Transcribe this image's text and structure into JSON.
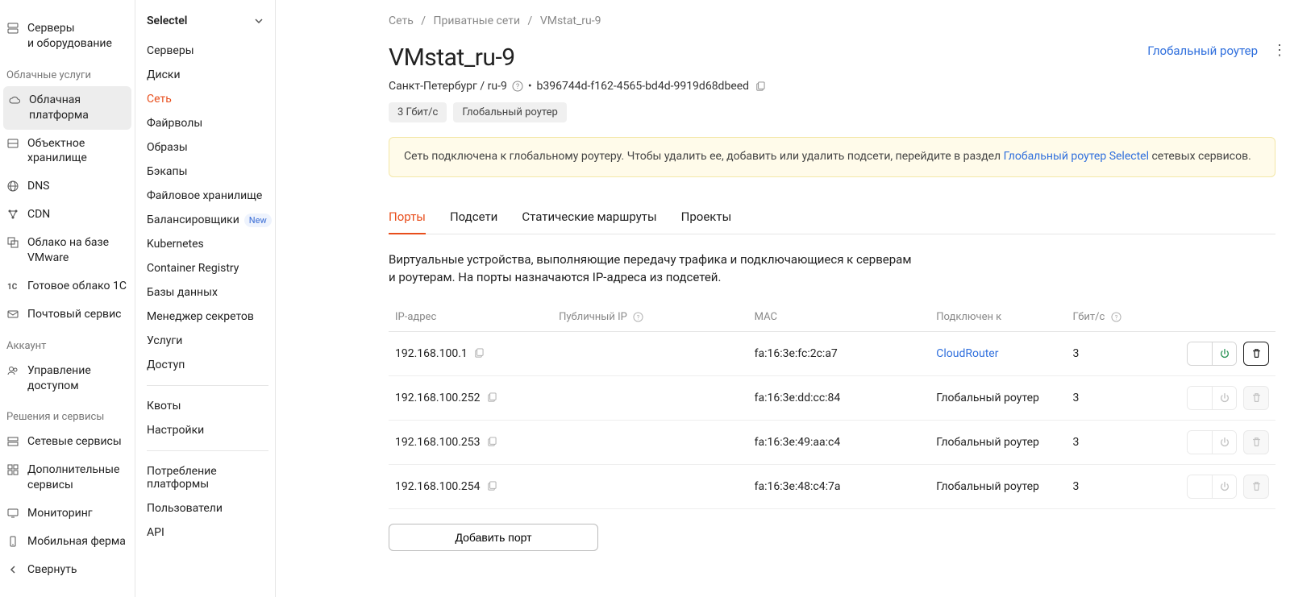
{
  "sidebar1": {
    "items_top": [
      {
        "label": "Серверы и оборудование",
        "icon": "server"
      }
    ],
    "group_cloud_label": "Облачные услуги",
    "items_cloud": [
      {
        "label": "Облачная платформа",
        "icon": "cloud",
        "active": true
      },
      {
        "label": "Объектное хранилище",
        "icon": "storage"
      },
      {
        "label": "DNS",
        "icon": "globe"
      },
      {
        "label": "CDN",
        "icon": "cdn"
      },
      {
        "label": "Облако на базе VMware",
        "icon": "vmware"
      },
      {
        "label": "Готовое облако 1C",
        "icon": "1c"
      },
      {
        "label": "Почтовый сервис",
        "icon": "mail"
      }
    ],
    "group_account_label": "Аккаунт",
    "items_account": [
      {
        "label": "Управление доступом",
        "icon": "users"
      }
    ],
    "group_solutions_label": "Решения и сервисы",
    "items_solutions": [
      {
        "label": "Сетевые сервисы",
        "icon": "network"
      },
      {
        "label": "Дополнительные сервисы",
        "icon": "extra"
      },
      {
        "label": "Мониторинг",
        "icon": "monitor"
      },
      {
        "label": "Мобильная ферма",
        "icon": "mobile"
      },
      {
        "label": "Свернуть",
        "icon": "collapse"
      }
    ]
  },
  "sidebar2": {
    "header": "Selectel",
    "items": [
      {
        "label": "Серверы"
      },
      {
        "label": "Диски"
      },
      {
        "label": "Сеть",
        "active": true
      },
      {
        "label": "Файрволы"
      },
      {
        "label": "Образы"
      },
      {
        "label": "Бэкапы"
      },
      {
        "label": "Файловое хранилище"
      },
      {
        "label": "Балансировщики",
        "badge": "New"
      },
      {
        "label": "Kubernetes"
      },
      {
        "label": "Container Registry"
      },
      {
        "label": "Базы данных"
      },
      {
        "label": "Менеджер секретов"
      },
      {
        "label": "Услуги"
      },
      {
        "label": "Доступ"
      }
    ],
    "items2": [
      {
        "label": "Квоты"
      },
      {
        "label": "Настройки"
      }
    ],
    "items3": [
      {
        "label": "Потребление платформы"
      },
      {
        "label": "Пользователи"
      },
      {
        "label": "API"
      }
    ]
  },
  "breadcrumb": {
    "a": "Сеть",
    "b": "Приватные сети",
    "c": "VMstat_ru-9"
  },
  "page": {
    "title": "VMstat_ru-9",
    "global_router_link": "Глобальный роутер",
    "location": "Санкт-Петербург / ru-9",
    "uuid": "b396744d-f162-4565-bd4d-9919d68dbeed",
    "chip_speed": "3 Гбит/с",
    "chip_router": "Глобальный роутер"
  },
  "alert": {
    "t1": "Сеть подключена к глобальному роутеру. Чтобы удалить ее, добавить или удалить подсети, перейдите в раздел ",
    "link": "Глобальный роутер Selectel",
    "t2": " сетевых сервисов."
  },
  "tabs": {
    "t1": "Порты",
    "t2": "Подсети",
    "t3": "Статические маршруты",
    "t4": "Проекты"
  },
  "desc": "Виртуальные устройства, выполняющие передачу трафика и подключающиеся к серверам и роутерам. На порты назначаются IP-адреса из подсетей.",
  "table": {
    "headers": {
      "ip": "IP-адрес",
      "public_ip": "Публичный IP",
      "mac": "MAC",
      "connected": "Подключен к",
      "gbit": "Гбит/с"
    },
    "rows": [
      {
        "ip": "192.168.100.1",
        "mac": "fa:16:3e:fc:2c:a7",
        "connected": "CloudRouter",
        "connected_link": true,
        "gbit": "3",
        "enabled": true
      },
      {
        "ip": "192.168.100.252",
        "mac": "fa:16:3e:dd:cc:84",
        "connected": "Глобальный роутер",
        "gbit": "3",
        "enabled": false
      },
      {
        "ip": "192.168.100.253",
        "mac": "fa:16:3e:49:aa:c4",
        "connected": "Глобальный роутер",
        "gbit": "3",
        "enabled": false
      },
      {
        "ip": "192.168.100.254",
        "mac": "fa:16:3e:48:c4:7a",
        "connected": "Глобальный роутер",
        "gbit": "3",
        "enabled": false
      }
    ],
    "add_port": "Добавить порт"
  }
}
